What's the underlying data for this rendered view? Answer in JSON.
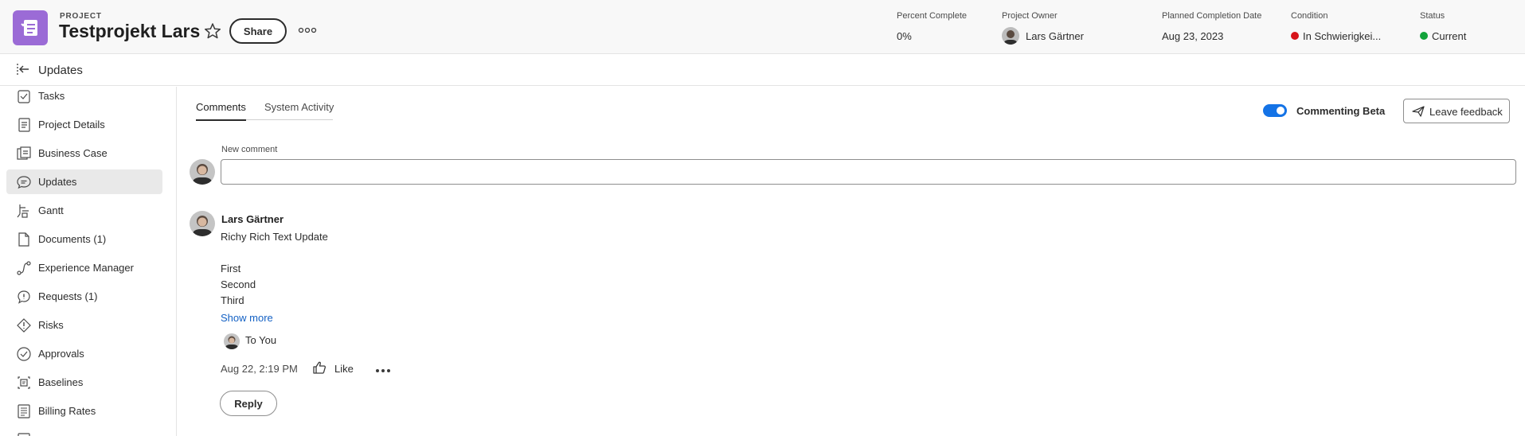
{
  "header": {
    "kicker": "PROJECT",
    "title": "Testprojekt Lars",
    "share_label": "Share",
    "meta": {
      "percent_complete": {
        "label": "Percent Complete",
        "value": "0%"
      },
      "project_owner": {
        "label": "Project Owner",
        "value": "Lars Gärtner"
      },
      "planned_completion": {
        "label": "Planned Completion Date",
        "value": "Aug 23, 2023"
      },
      "condition": {
        "label": "Condition",
        "value": "In Schwierigkei...",
        "color": "#d7141a"
      },
      "status": {
        "label": "Status",
        "value": "Current",
        "color": "#12a33a"
      }
    },
    "brand_color": "#9b6bd6"
  },
  "subheader": {
    "title": "Updates"
  },
  "sidebar": {
    "items": [
      {
        "label": "Tasks",
        "icon": "tasks-icon"
      },
      {
        "label": "Project Details",
        "icon": "details-icon"
      },
      {
        "label": "Business Case",
        "icon": "business-case-icon"
      },
      {
        "label": "Updates",
        "icon": "updates-icon",
        "active": true
      },
      {
        "label": "Gantt",
        "icon": "gantt-icon"
      },
      {
        "label": "Documents (1)",
        "icon": "document-icon"
      },
      {
        "label": "Experience Manager",
        "icon": "experience-manager-icon"
      },
      {
        "label": "Requests (1)",
        "icon": "requests-icon"
      },
      {
        "label": "Risks",
        "icon": "risk-icon"
      },
      {
        "label": "Approvals",
        "icon": "approval-icon"
      },
      {
        "label": "Baselines",
        "icon": "baseline-icon"
      },
      {
        "label": "Billing Rates",
        "icon": "billing-icon"
      }
    ]
  },
  "main": {
    "tabs": [
      {
        "label": "Comments",
        "active": true
      },
      {
        "label": "System Activity",
        "active": false
      }
    ],
    "commenting_beta": {
      "label": "Commenting Beta",
      "enabled": true
    },
    "feedback_label": "Leave feedback",
    "new_comment": {
      "label": "New comment",
      "value": "",
      "placeholder": ""
    },
    "comment": {
      "author": "Lars Gärtner",
      "title": "Richy Rich Text Update",
      "lines": [
        "First",
        "Second",
        "Third"
      ],
      "show_more": "Show more",
      "to_prefix": "To",
      "to_target": "You",
      "timestamp": "Aug 22, 2:19 PM",
      "like_label": "Like",
      "reply_label": "Reply"
    },
    "accent_color": "#1473e6"
  }
}
